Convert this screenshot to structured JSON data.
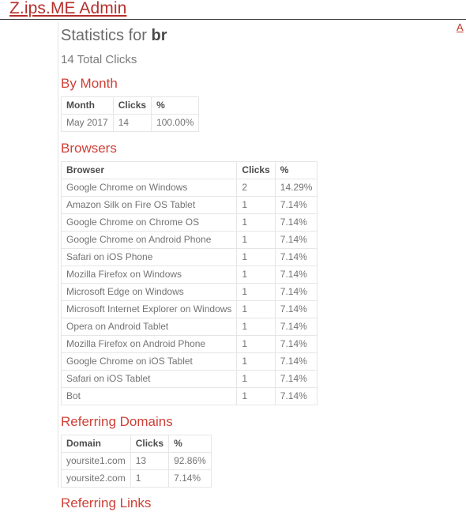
{
  "navbar": {
    "brand": "Z.ips.ME Admin",
    "right_link_partial": "A"
  },
  "main": {
    "title_prefix": "Statistics for ",
    "title_target": "br",
    "total_clicks": "14 Total Clicks",
    "sections": {
      "by_month": {
        "heading": "By Month",
        "columns": [
          "Month",
          "Clicks",
          "%"
        ],
        "rows": [
          [
            "May 2017",
            "14",
            "100.00%"
          ]
        ]
      },
      "browsers": {
        "heading": "Browsers",
        "columns": [
          "Browser",
          "Clicks",
          "%"
        ],
        "rows": [
          [
            "Google Chrome on Windows",
            "2",
            "14.29%"
          ],
          [
            "Amazon Silk on Fire OS Tablet",
            "1",
            "7.14%"
          ],
          [
            "Google Chrome on Chrome OS",
            "1",
            "7.14%"
          ],
          [
            "Google Chrome on Android Phone",
            "1",
            "7.14%"
          ],
          [
            "Safari on iOS Phone",
            "1",
            "7.14%"
          ],
          [
            "Mozilla Firefox on Windows",
            "1",
            "7.14%"
          ],
          [
            "Microsoft Edge on Windows",
            "1",
            "7.14%"
          ],
          [
            "Microsoft Internet Explorer on Windows",
            "1",
            "7.14%"
          ],
          [
            "Opera on Android Tablet",
            "1",
            "7.14%"
          ],
          [
            "Mozilla Firefox on Android Phone",
            "1",
            "7.14%"
          ],
          [
            "Google Chrome on iOS Tablet",
            "1",
            "7.14%"
          ],
          [
            "Safari on iOS Tablet",
            "1",
            "7.14%"
          ],
          [
            "Bot",
            "1",
            "7.14%"
          ]
        ]
      },
      "referring_domains": {
        "heading": "Referring Domains",
        "columns": [
          "Domain",
          "Clicks",
          "%"
        ],
        "rows": [
          [
            "yoursite1.com",
            "13",
            "92.86%"
          ],
          [
            "yoursite2.com",
            "1",
            "7.14%"
          ]
        ]
      },
      "referring_links": {
        "heading": "Referring Links"
      }
    }
  },
  "colors": {
    "brand_red": "#b5302c",
    "heading_red": "#cf4037",
    "text_gray": "#737373",
    "border_gray": "#e6e6e6"
  }
}
